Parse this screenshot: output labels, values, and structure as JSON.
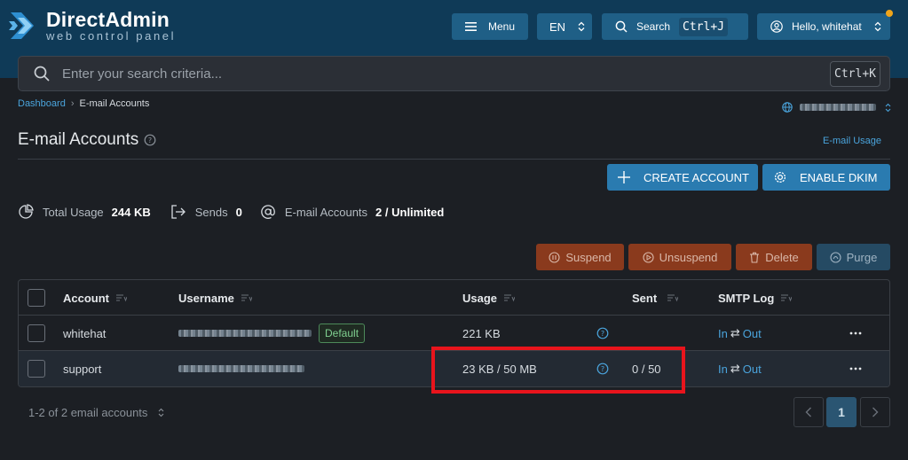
{
  "header": {
    "logo_title": "DirectAdmin",
    "logo_sub": "web control panel",
    "menu_label": "Menu",
    "lang_label": "EN",
    "search_label": "Search",
    "search_kbd": "Ctrl+J",
    "user_label": "Hello, whitehat"
  },
  "search": {
    "placeholder": "Enter your search criteria...",
    "kbd": "Ctrl+K"
  },
  "breadcrumb": {
    "home": "Dashboard",
    "current": "E-mail Accounts"
  },
  "page": {
    "title": "E-mail Accounts",
    "usage_link": "E-mail Usage"
  },
  "actions": {
    "create": "CREATE ACCOUNT",
    "dkim": "ENABLE DKIM"
  },
  "stats": {
    "total_usage_label": "Total Usage",
    "total_usage_value": "244 KB",
    "sends_label": "Sends",
    "sends_value": "0",
    "accounts_label": "E-mail Accounts",
    "accounts_value": "2 / Unlimited"
  },
  "bulk": {
    "suspend": "Suspend",
    "unsuspend": "Unsuspend",
    "delete": "Delete",
    "purge": "Purge"
  },
  "table": {
    "headers": {
      "account": "Account",
      "username": "Username",
      "usage": "Usage",
      "sent": "Sent",
      "smtp": "SMTP Log"
    },
    "rows": [
      {
        "account": "whitehat",
        "badge": "Default",
        "usage": "221 KB",
        "sent": "",
        "in": "In",
        "out": "Out"
      },
      {
        "account": "support",
        "badge": "",
        "usage": "23 KB / 50 MB",
        "sent": "0 / 50",
        "in": "In",
        "out": "Out"
      }
    ]
  },
  "footer": {
    "count": "1-2 of 2 email accounts",
    "page": "1"
  },
  "colors": {
    "accent": "#2a7bb0",
    "header_bg": "#0f3a57",
    "highlight_box": "#e8141c"
  }
}
